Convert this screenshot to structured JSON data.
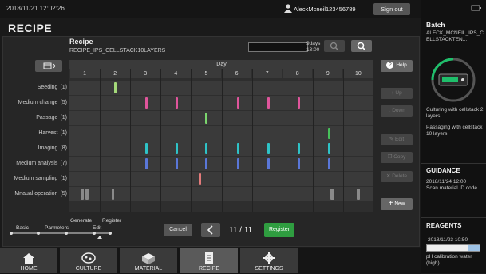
{
  "topbar": {
    "datetime": "2018/11/21  12:02:26",
    "user": "AleckMcneil123456789",
    "signout": "Sign out"
  },
  "screen_title": "RECIPE",
  "recipe": {
    "title": "Recipe",
    "name": "RECIPE_IPS_CELLSTACK10LAYERS",
    "duration_days": "9days",
    "duration_time": "13:00"
  },
  "grid": {
    "header": "Day",
    "days": [
      "1",
      "2",
      "3",
      "4",
      "5",
      "6",
      "7",
      "8",
      "9",
      "10"
    ],
    "rows": [
      {
        "label": "Seeding",
        "count": "(1)",
        "color": "#a4d97a"
      },
      {
        "label": "Medium change",
        "count": "(5)",
        "color": "#e0559c"
      },
      {
        "label": "Passage",
        "count": "(1)",
        "color": "#7bd66e"
      },
      {
        "label": "Harvest",
        "count": "(1)",
        "color": "#47c05a"
      },
      {
        "label": "Imaging",
        "count": "(8)",
        "color": "#2ec3c7"
      },
      {
        "label": "Medium analysis",
        "count": "(7)",
        "color": "#5a77d8"
      },
      {
        "label": "Medium sampling",
        "count": "(1)",
        "color": "#e47b7b"
      },
      {
        "label": "Mnaual operation",
        "count": "(5)",
        "color": "#8a8a8a"
      }
    ]
  },
  "side_buttons": {
    "help": "Help",
    "up": "Up",
    "down": "Down",
    "edit": "Edit",
    "copy": "Copy",
    "delete": "Delete",
    "new": "New"
  },
  "wizard": {
    "steps": [
      "Basic",
      "Parmeters",
      "Generate",
      "Edit",
      "Register"
    ]
  },
  "footer": {
    "cancel": "Cancel",
    "page": "11 / 11",
    "register": "Register"
  },
  "nav": {
    "home": "HOME",
    "culture": "CULTURE",
    "material": "MATERIAL",
    "recipe": "RECIPE",
    "settings": "SETTINGS"
  },
  "right": {
    "batch_title": "Batch",
    "batch_name": "ALECK_MCNEIL_IPS_CELLSTACKTEN...",
    "status1": "Culturing with cellstack 2 layers.",
    "status2": "Passaging with cellstack 10 layers.",
    "guidance_title": "GUIDANCE",
    "guidance_time": "2018/11/24  12:00",
    "guidance_text": "Scan material ID code.",
    "reagents_title": "REAGENTS",
    "reagent_time": "2018/11/23  10:50",
    "reagent_level_pct": 70,
    "reagent_name": "pH calibration water (high)"
  }
}
